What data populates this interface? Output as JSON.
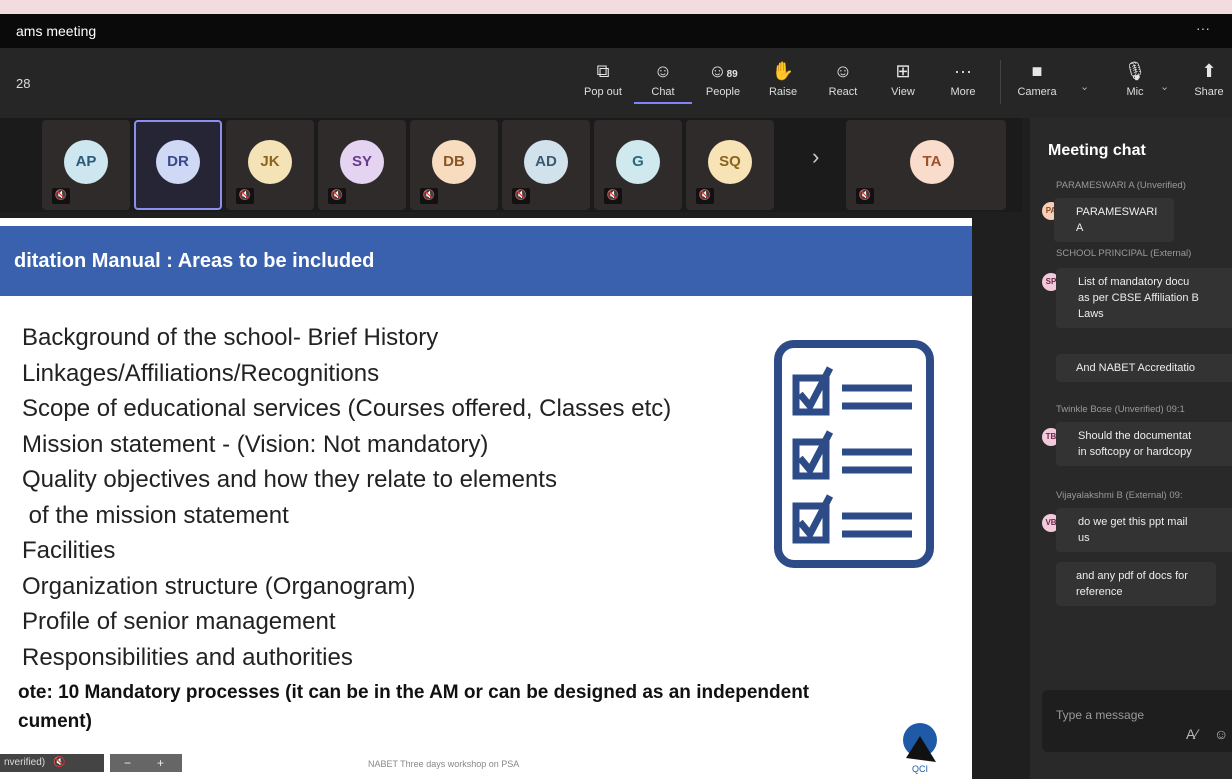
{
  "window": {
    "title": "ams meeting",
    "timer": "28",
    "more": "···"
  },
  "toolbar": {
    "buttons": [
      {
        "label": "Pop out",
        "icon": "pop-out-icon",
        "glyph": "⧉"
      },
      {
        "label": "Chat",
        "icon": "chat-icon",
        "glyph": "☺"
      },
      {
        "label": "People",
        "icon": "people-icon",
        "glyph": "👥",
        "count": "89"
      },
      {
        "label": "Raise",
        "icon": "raise-hand-icon",
        "glyph": "✋"
      },
      {
        "label": "React",
        "icon": "react-icon",
        "glyph": "☺"
      },
      {
        "label": "View",
        "icon": "view-icon",
        "glyph": "⊞"
      },
      {
        "label": "More",
        "icon": "more-icon",
        "glyph": "···"
      }
    ],
    "camera": "Camera",
    "mic": "Mic",
    "share": "Share"
  },
  "participants": [
    {
      "initials": "AP",
      "bg": "#cde6f0",
      "fg": "#2a5a7a"
    },
    {
      "initials": "DR",
      "bg": "#cfd8f5",
      "fg": "#3a4a8a",
      "selected": true
    },
    {
      "initials": "JK",
      "bg": "#f5e3b8",
      "fg": "#8a6320"
    },
    {
      "initials": "SY",
      "bg": "#e5d3f2",
      "fg": "#6a3a8a"
    },
    {
      "initials": "DB",
      "bg": "#f7dcbf",
      "fg": "#8a5526"
    },
    {
      "initials": "AD",
      "bg": "#d2e2ec",
      "fg": "#3a5a70"
    },
    {
      "initials": "G",
      "bg": "#cfe9ee",
      "fg": "#2a6a7a"
    },
    {
      "initials": "SQ",
      "bg": "#f7e3b5",
      "fg": "#8a6320"
    },
    {
      "initials": "TA",
      "bg": "#f9dccb",
      "fg": "#a0502a"
    }
  ],
  "slide": {
    "heading": "ditation Manual : Areas to be included",
    "bullets": [
      "Background of the school- Brief History",
      "Linkages/Affiliations/Recognitions",
      "Scope of educational services (Courses offered, Classes etc)",
      "Mission statement - (Vision: Not mandatory)",
      "Quality objectives and how they relate to elements",
      " of the mission statement",
      "Facilities",
      "Organization structure (Organogram)",
      "Profile of senior management",
      "Responsibilities and authorities"
    ],
    "note_line1": "ote: 10 Mandatory processes (it can be in the AM or can be designed as an independent",
    "note_line2": "cument)",
    "footer": "NABET Three days workshop on PSA",
    "pill": "nverified)",
    "logo": "QCI"
  },
  "chat": {
    "title": "Meeting chat",
    "messages": [
      {
        "meta": "PARAMESWARI A (Unverified)",
        "avatar": "PA",
        "lines": [
          "PARAMESWARI A"
        ]
      },
      {
        "meta": "SCHOOL PRINCIPAL (External)",
        "avatar": "SP",
        "lines": [
          "List of mandatory docu",
          "as per CBSE Affiliation B",
          "Laws"
        ],
        "extra": "And NABET Accreditatio"
      },
      {
        "meta": "Twinkle Bose (Unverified)  09:1",
        "avatar": "TB",
        "lines": [
          "Should the documentat",
          "in softcopy or hardcopy"
        ]
      },
      {
        "meta": "Vijayalakshmi B (External)  09:",
        "avatar": "VB",
        "lines": [
          "do we get this ppt mail",
          "us"
        ],
        "extra": "and any pdf of docs for reference"
      }
    ],
    "compose_placeholder": "Type a message"
  }
}
